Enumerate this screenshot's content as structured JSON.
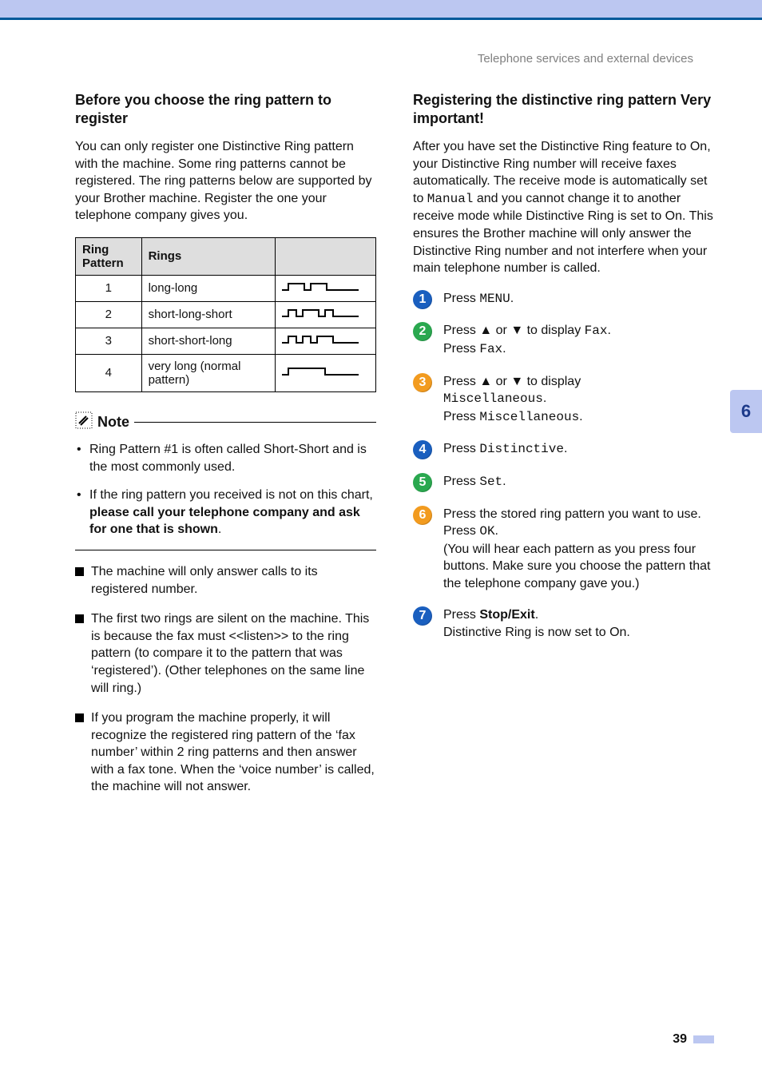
{
  "header": {
    "breadcrumb": "Telephone services and external devices"
  },
  "left": {
    "h1": "Before you choose the ring pattern to register",
    "intro": "You can only register one Distinctive Ring pattern with the machine. Some ring patterns cannot be registered. The ring patterns below are supported by your Brother machine. Register the one your telephone company gives you.",
    "table": {
      "col1": "Ring Pattern",
      "col2": "Rings",
      "rows": [
        {
          "num": "1",
          "desc": "long-long"
        },
        {
          "num": "2",
          "desc": "short-long-short"
        },
        {
          "num": "3",
          "desc": "short-short-long"
        },
        {
          "num": "4",
          "desc": "very long (normal pattern)"
        }
      ]
    },
    "note_label": "Note",
    "note_items": {
      "a": "Ring Pattern #1 is often called Short-Short and is the most commonly used.",
      "b_pre": "If the ring pattern you received is not on this chart, ",
      "b_bold": "please call your telephone company and ask for one that is shown",
      "b_post": "."
    },
    "bullets": {
      "a": "The machine will only answer calls to its registered number.",
      "b": "The first two rings are silent on the machine. This is because the fax must <<listen>> to the ring pattern (to compare it to the pattern that was ‘registered’). (Other telephones on the same line will ring.)",
      "c": "If you program the machine properly, it will recognize the registered ring pattern of the ‘fax number’ within 2 ring patterns and then answer with a fax tone. When the ‘voice number’ is called, the machine will not answer."
    }
  },
  "right": {
    "h1": "Registering the distinctive ring pattern Very important!",
    "intro_pre": "After you have set the Distinctive Ring feature to On, your Distinctive Ring number will receive faxes automatically. The receive mode is automatically set to ",
    "intro_mono1": "Manual",
    "intro_post": " and you cannot change it to another receive mode while Distinctive Ring is set to On. This ensures the Brother machine will only answer the Distinctive Ring number and not interfere when your main telephone number is called.",
    "steps": {
      "s1": {
        "pre": "Press ",
        "mono": "MENU",
        "post": "."
      },
      "s2": {
        "line1_pre": "Press ",
        "up": "▲",
        "or": " or ",
        "down": "▼",
        "mid": " to display ",
        "mono1": "Fax",
        "post1": ".",
        "line2_pre": "Press ",
        "mono2": "Fax",
        "post2": "."
      },
      "s3": {
        "line1_pre": "Press ",
        "up": "▲",
        "or": " or ",
        "down": "▼",
        "mid": " to display ",
        "mono1": "Miscellaneous",
        "post1": ".",
        "line2_pre": "Press ",
        "mono2": "Miscellaneous",
        "post2": "."
      },
      "s4": {
        "pre": "Press ",
        "mono": "Distinctive",
        "post": "."
      },
      "s5": {
        "pre": "Press ",
        "mono": "Set",
        "post": "."
      },
      "s6": {
        "line1": "Press the stored ring pattern you want to use.",
        "line2_pre": "Press ",
        "mono": "OK",
        "post": ".",
        "line3": "(You will hear each pattern as you press four buttons. Make sure you choose the pattern that the telephone company gave you.)"
      },
      "s7": {
        "line1_pre": "Press ",
        "bold": "Stop/Exit",
        "post1": ".",
        "line2": "Distinctive Ring is now set to On."
      }
    },
    "step_colors": [
      "#1a5fbf",
      "#2aa84f",
      "#f29b1f",
      "#1a5fbf",
      "#2aa84f",
      "#f29b1f",
      "#1a5fbf"
    ]
  },
  "sidetab": "6",
  "pagenum": "39",
  "chart_data": {
    "type": "table",
    "title": "Ring patterns",
    "columns": [
      "Ring Pattern",
      "Rings"
    ],
    "rows": [
      [
        "1",
        "long-long"
      ],
      [
        "2",
        "short-long-short"
      ],
      [
        "3",
        "short-short-long"
      ],
      [
        "4",
        "very long (normal pattern)"
      ]
    ]
  }
}
